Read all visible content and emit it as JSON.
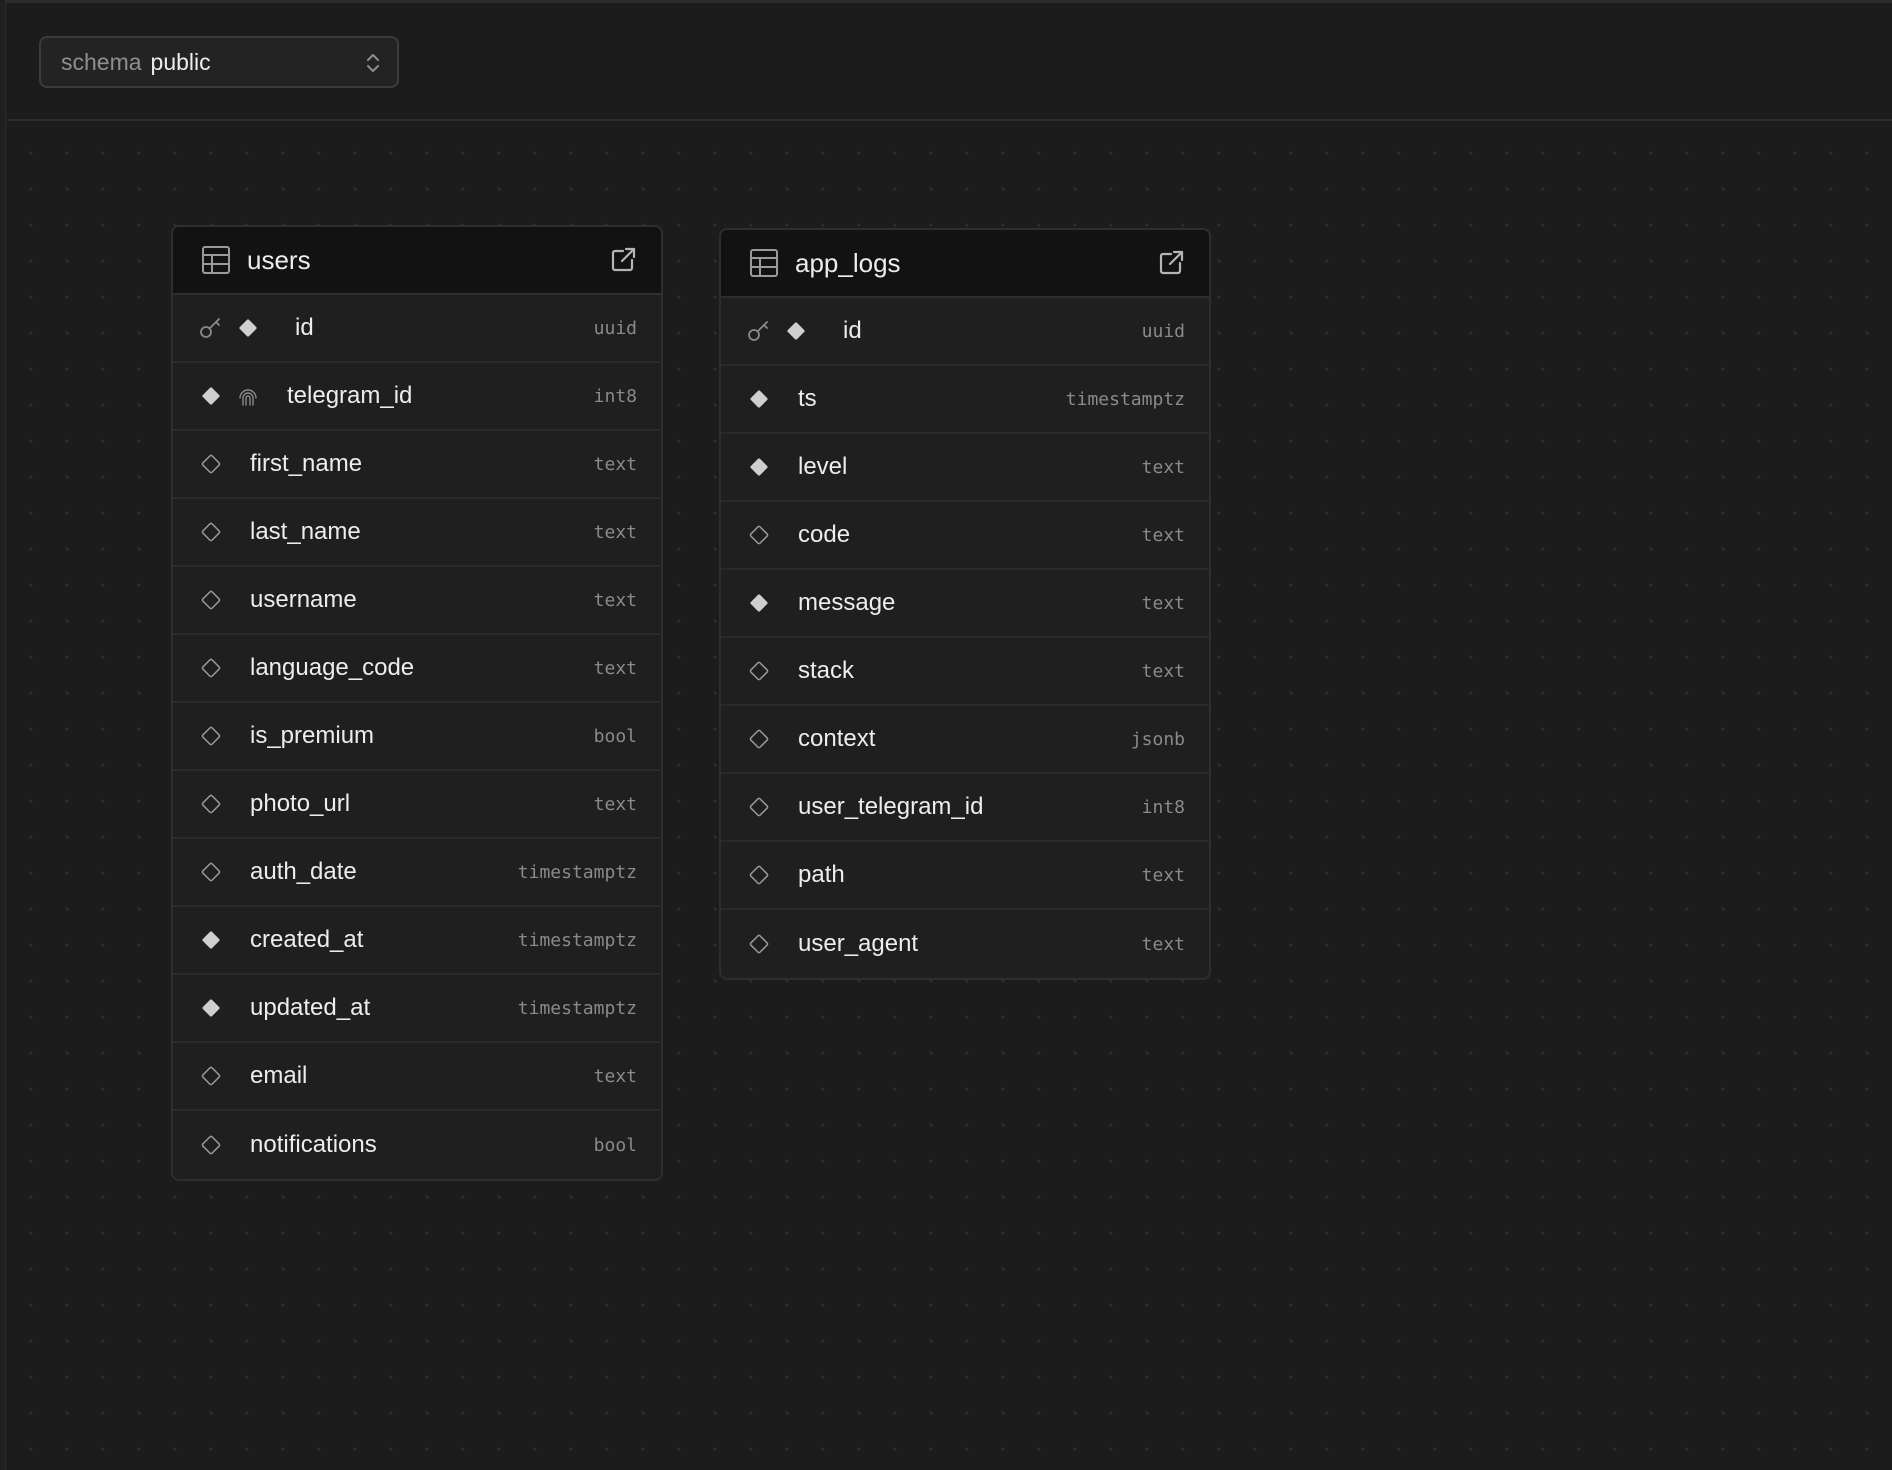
{
  "toolbar": {
    "schema_label": "schema",
    "schema_value": "public"
  },
  "tables": [
    {
      "name": "users",
      "columns": [
        {
          "name": "id",
          "type": "uuid",
          "primary_key": true,
          "not_null": true,
          "unique": false
        },
        {
          "name": "telegram_id",
          "type": "int8",
          "primary_key": false,
          "not_null": true,
          "unique": true
        },
        {
          "name": "first_name",
          "type": "text",
          "primary_key": false,
          "not_null": false,
          "unique": false
        },
        {
          "name": "last_name",
          "type": "text",
          "primary_key": false,
          "not_null": false,
          "unique": false
        },
        {
          "name": "username",
          "type": "text",
          "primary_key": false,
          "not_null": false,
          "unique": false
        },
        {
          "name": "language_code",
          "type": "text",
          "primary_key": false,
          "not_null": false,
          "unique": false
        },
        {
          "name": "is_premium",
          "type": "bool",
          "primary_key": false,
          "not_null": false,
          "unique": false
        },
        {
          "name": "photo_url",
          "type": "text",
          "primary_key": false,
          "not_null": false,
          "unique": false
        },
        {
          "name": "auth_date",
          "type": "timestamptz",
          "primary_key": false,
          "not_null": false,
          "unique": false
        },
        {
          "name": "created_at",
          "type": "timestamptz",
          "primary_key": false,
          "not_null": true,
          "unique": false
        },
        {
          "name": "updated_at",
          "type": "timestamptz",
          "primary_key": false,
          "not_null": true,
          "unique": false
        },
        {
          "name": "email",
          "type": "text",
          "primary_key": false,
          "not_null": false,
          "unique": false
        },
        {
          "name": "notifications",
          "type": "bool",
          "primary_key": false,
          "not_null": false,
          "unique": false
        }
      ]
    },
    {
      "name": "app_logs",
      "columns": [
        {
          "name": "id",
          "type": "uuid",
          "primary_key": true,
          "not_null": true,
          "unique": false
        },
        {
          "name": "ts",
          "type": "timestamptz",
          "primary_key": false,
          "not_null": true,
          "unique": false
        },
        {
          "name": "level",
          "type": "text",
          "primary_key": false,
          "not_null": true,
          "unique": false
        },
        {
          "name": "code",
          "type": "text",
          "primary_key": false,
          "not_null": false,
          "unique": false
        },
        {
          "name": "message",
          "type": "text",
          "primary_key": false,
          "not_null": true,
          "unique": false
        },
        {
          "name": "stack",
          "type": "text",
          "primary_key": false,
          "not_null": false,
          "unique": false
        },
        {
          "name": "context",
          "type": "jsonb",
          "primary_key": false,
          "not_null": false,
          "unique": false
        },
        {
          "name": "user_telegram_id",
          "type": "int8",
          "primary_key": false,
          "not_null": false,
          "unique": false
        },
        {
          "name": "path",
          "type": "text",
          "primary_key": false,
          "not_null": false,
          "unique": false
        },
        {
          "name": "user_agent",
          "type": "text",
          "primary_key": false,
          "not_null": false,
          "unique": false
        }
      ]
    }
  ],
  "icons": {
    "table": "table-icon",
    "open": "external-link-icon",
    "primary_key": "key-icon",
    "not_null": "filled-diamond-icon",
    "nullable": "outline-diamond-icon",
    "unique": "fingerprint-icon",
    "schema_dropdown": "chevron-up-down-icon"
  },
  "colors": {
    "background": "#1c1c1c",
    "header": "#121212",
    "text": "#ededed",
    "muted": "#8a8a8a"
  }
}
